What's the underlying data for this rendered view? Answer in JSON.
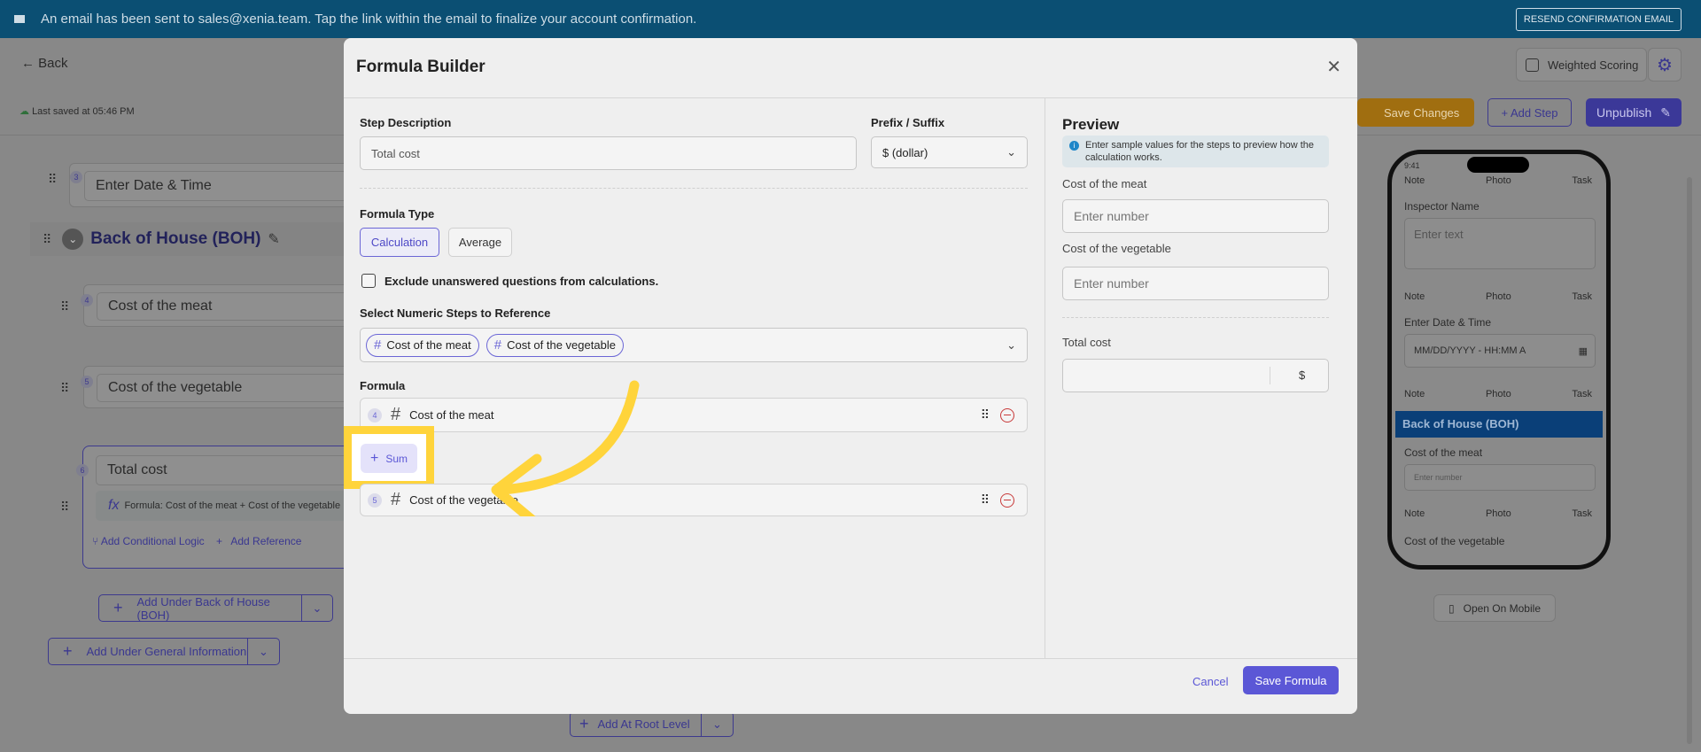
{
  "banner": {
    "message": "An email has been sent to sales@xenia.team. Tap the link within the email to finalize your account confirmation.",
    "resend_label": "RESEND CONFIRMATION EMAIL"
  },
  "header": {
    "back_label": "Back",
    "last_saved": "Last saved at 05:46 PM",
    "weighted_scoring_label": "Weighted Scoring",
    "save_changes_label": "Save Changes",
    "add_step_label": "+ Add Step",
    "unpublish_label": "Unpublish"
  },
  "builder": {
    "items": [
      {
        "number": "3",
        "label": "Enter Date & Time"
      },
      {
        "number": "4",
        "label": "Cost of the meat"
      },
      {
        "number": "5",
        "label": "Cost of the vegetable"
      },
      {
        "number": "6",
        "label": "Total cost",
        "formula": "Formula: Cost of the meat + Cost of the vegetable"
      }
    ],
    "section_title": "Back of House (BOH)",
    "add_conditional_logic": "Add Conditional Logic",
    "add_reference": "Add Reference",
    "add_under_section": "Add Under Back of House (BOH)",
    "add_under_general": "Add Under General Information",
    "add_at_root": "Add At Root Level"
  },
  "modal": {
    "title": "Formula Builder",
    "step_description_label": "Step Description",
    "step_description_value": "Total cost",
    "prefix_suffix_label": "Prefix / Suffix",
    "prefix_suffix_value": "$ (dollar)",
    "formula_type_label": "Formula Type",
    "formula_types": [
      "Calculation",
      "Average"
    ],
    "selected_formula_type": "Calculation",
    "exclude_label": "Exclude unanswered questions from calculations.",
    "exclude_checked": false,
    "select_steps_label": "Select Numeric Steps to Reference",
    "selected_steps": [
      "Cost of the meat",
      "Cost of the vegetable"
    ],
    "formula_label": "Formula",
    "formula_rows": [
      {
        "number": "4",
        "label": "Cost of the meat"
      },
      {
        "number": "5",
        "label": "Cost of the vegetable"
      }
    ],
    "operator_label": "Sum",
    "cancel_label": "Cancel",
    "save_label": "Save Formula",
    "preview": {
      "title": "Preview",
      "info": "Enter sample values for the steps to preview how the calculation works.",
      "fields": [
        {
          "label": "Cost of the meat",
          "placeholder": "Enter number"
        },
        {
          "label": "Cost of the vegetable",
          "placeholder": "Enter number"
        }
      ],
      "result_label": "Total cost",
      "result_unit": "$"
    }
  },
  "phone": {
    "time": "9:41",
    "note": "Note",
    "photo": "Photo",
    "task": "Task",
    "inspector_label": "Inspector Name",
    "inspector_placeholder": "Enter text",
    "datetime_label": "Enter Date & Time",
    "datetime_placeholder": "MM/DD/YYYY - HH:MM A",
    "section": "Back of House (BOH)",
    "meat_label": "Cost of the meat",
    "meat_placeholder": "Enter number",
    "veg_label": "Cost of the vegetable"
  },
  "open_on_mobile": "Open On Mobile",
  "colors": {
    "accent": "#5b57d6",
    "highlight": "#ffd43b",
    "banner": "#0b4f73",
    "save_changes": "#c98a0f",
    "danger": "#c83a3a"
  }
}
